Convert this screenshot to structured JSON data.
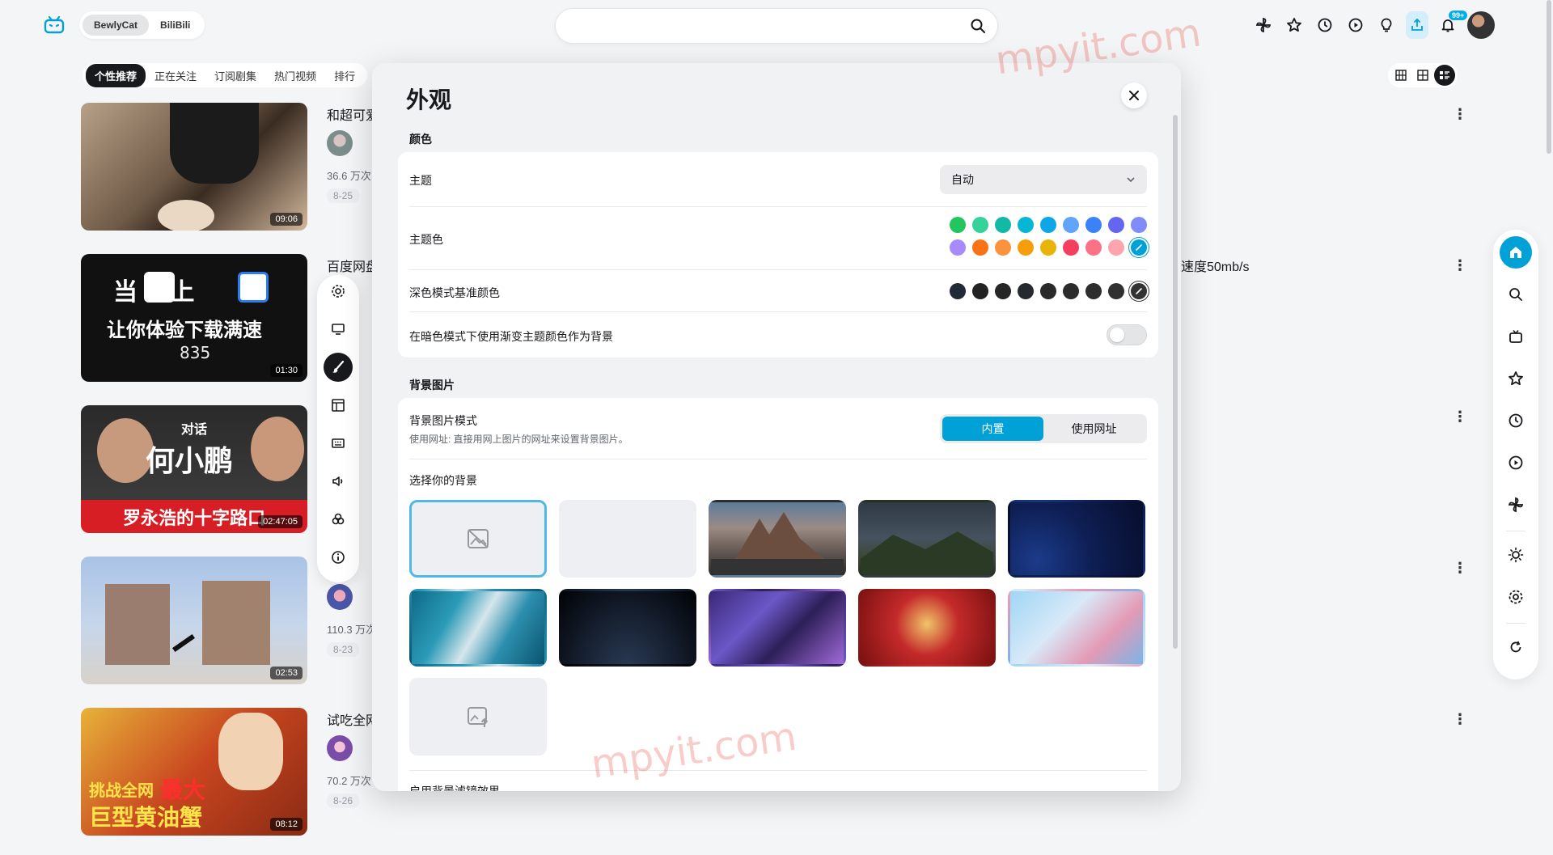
{
  "header": {
    "tabs": [
      "BewlyCat",
      "BiliBili"
    ],
    "active_tab": "BewlyCat",
    "notification_badge": "99+"
  },
  "feed_tabs": [
    "个性推荐",
    "正在关注",
    "订阅剧集",
    "热门视频",
    "排行"
  ],
  "feed_items": [
    {
      "title": "和超可爱",
      "stats": "36.6 万次",
      "date": "8-25",
      "duration": "09:06",
      "thumb_text": ""
    },
    {
      "title": "百度网盘",
      "stats": "",
      "date": "",
      "duration": "01:30",
      "extra_right": "速度50mb/s",
      "thumb_line1": "当  遇上",
      "thumb_line2": "让你体验下载满速",
      "thumb_line3": "835"
    },
    {
      "title": "",
      "stats": "",
      "date": "",
      "duration": "02:47:05",
      "thumb_line1": "对话",
      "thumb_line2": "何小鹏",
      "thumb_line3": "罗永浩的十字路口"
    },
    {
      "title": "",
      "stats": "110.3 万次",
      "date": "8-23",
      "duration": "02:53"
    },
    {
      "title": "试吃全网",
      "stats": "70.2 万次",
      "date": "8-26",
      "duration": "08:12",
      "thumb_line1": "挑战全网",
      "thumb_line2": "最大",
      "thumb_line3": "巨型黄油蟹"
    }
  ],
  "dialog": {
    "title": "外观",
    "section_color": "颜色",
    "theme_label": "主题",
    "theme_value": "自动",
    "theme_color_label": "主题色",
    "dark_base_label": "深色模式基准颜色",
    "gradient_label": "在暗色模式下使用渐变主题颜色作为背景",
    "section_bg": "背景图片",
    "bg_mode_label": "背景图片模式",
    "bg_mode_desc": "使用网址: 直接用网上图片的网址来设置背景图片。",
    "bg_mode_options": [
      "内置",
      "使用网址"
    ],
    "bg_choose_label": "选择你的背景",
    "next_row_label": "启用背景滤镜效果"
  },
  "theme_colors": [
    "#22c55e",
    "#34d399",
    "#14b8a6",
    "#06b6d4",
    "#0ea5e9",
    "#60a5fa",
    "#3b82f6",
    "#6366f1",
    "#818cf8",
    "#a78bfa",
    "#f97316",
    "#fb923c",
    "#f59e0b",
    "#eab308",
    "#f43f5e",
    "#fb7185",
    "#fda4af",
    "#00a1d6"
  ],
  "dark_colors": [
    "#1f2937",
    "#232323",
    "#262626",
    "#262a2f",
    "#2a2a2a",
    "#2b2b2b",
    "#2d2d2d",
    "#303030",
    "#333333"
  ],
  "watermark": "mpyit.com"
}
